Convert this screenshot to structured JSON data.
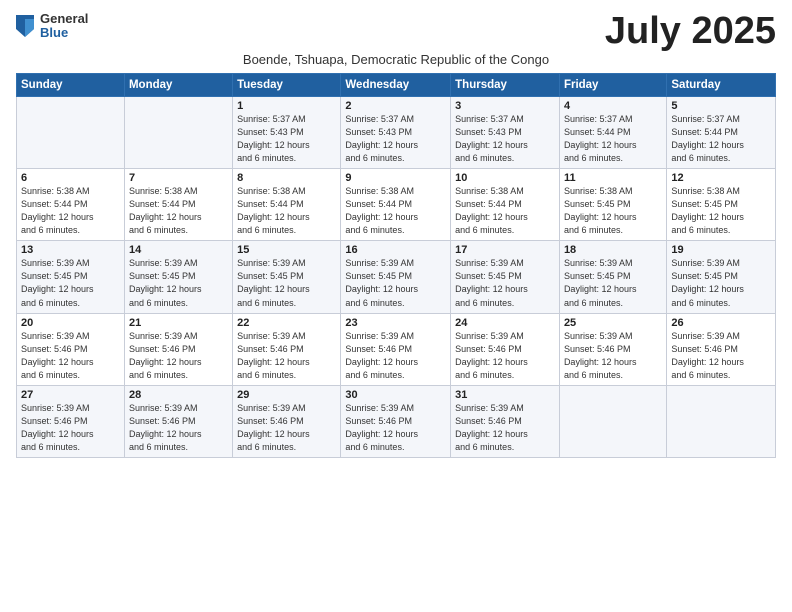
{
  "logo": {
    "general": "General",
    "blue": "Blue"
  },
  "title": "July 2025",
  "subtitle": "Boende, Tshuapa, Democratic Republic of the Congo",
  "days_header": [
    "Sunday",
    "Monday",
    "Tuesday",
    "Wednesday",
    "Thursday",
    "Friday",
    "Saturday"
  ],
  "weeks": [
    [
      {
        "day": "",
        "info": ""
      },
      {
        "day": "",
        "info": ""
      },
      {
        "day": "1",
        "info": "Sunrise: 5:37 AM\nSunset: 5:43 PM\nDaylight: 12 hours\nand 6 minutes."
      },
      {
        "day": "2",
        "info": "Sunrise: 5:37 AM\nSunset: 5:43 PM\nDaylight: 12 hours\nand 6 minutes."
      },
      {
        "day": "3",
        "info": "Sunrise: 5:37 AM\nSunset: 5:43 PM\nDaylight: 12 hours\nand 6 minutes."
      },
      {
        "day": "4",
        "info": "Sunrise: 5:37 AM\nSunset: 5:44 PM\nDaylight: 12 hours\nand 6 minutes."
      },
      {
        "day": "5",
        "info": "Sunrise: 5:37 AM\nSunset: 5:44 PM\nDaylight: 12 hours\nand 6 minutes."
      }
    ],
    [
      {
        "day": "6",
        "info": "Sunrise: 5:38 AM\nSunset: 5:44 PM\nDaylight: 12 hours\nand 6 minutes."
      },
      {
        "day": "7",
        "info": "Sunrise: 5:38 AM\nSunset: 5:44 PM\nDaylight: 12 hours\nand 6 minutes."
      },
      {
        "day": "8",
        "info": "Sunrise: 5:38 AM\nSunset: 5:44 PM\nDaylight: 12 hours\nand 6 minutes."
      },
      {
        "day": "9",
        "info": "Sunrise: 5:38 AM\nSunset: 5:44 PM\nDaylight: 12 hours\nand 6 minutes."
      },
      {
        "day": "10",
        "info": "Sunrise: 5:38 AM\nSunset: 5:44 PM\nDaylight: 12 hours\nand 6 minutes."
      },
      {
        "day": "11",
        "info": "Sunrise: 5:38 AM\nSunset: 5:45 PM\nDaylight: 12 hours\nand 6 minutes."
      },
      {
        "day": "12",
        "info": "Sunrise: 5:38 AM\nSunset: 5:45 PM\nDaylight: 12 hours\nand 6 minutes."
      }
    ],
    [
      {
        "day": "13",
        "info": "Sunrise: 5:39 AM\nSunset: 5:45 PM\nDaylight: 12 hours\nand 6 minutes."
      },
      {
        "day": "14",
        "info": "Sunrise: 5:39 AM\nSunset: 5:45 PM\nDaylight: 12 hours\nand 6 minutes."
      },
      {
        "day": "15",
        "info": "Sunrise: 5:39 AM\nSunset: 5:45 PM\nDaylight: 12 hours\nand 6 minutes."
      },
      {
        "day": "16",
        "info": "Sunrise: 5:39 AM\nSunset: 5:45 PM\nDaylight: 12 hours\nand 6 minutes."
      },
      {
        "day": "17",
        "info": "Sunrise: 5:39 AM\nSunset: 5:45 PM\nDaylight: 12 hours\nand 6 minutes."
      },
      {
        "day": "18",
        "info": "Sunrise: 5:39 AM\nSunset: 5:45 PM\nDaylight: 12 hours\nand 6 minutes."
      },
      {
        "day": "19",
        "info": "Sunrise: 5:39 AM\nSunset: 5:45 PM\nDaylight: 12 hours\nand 6 minutes."
      }
    ],
    [
      {
        "day": "20",
        "info": "Sunrise: 5:39 AM\nSunset: 5:46 PM\nDaylight: 12 hours\nand 6 minutes."
      },
      {
        "day": "21",
        "info": "Sunrise: 5:39 AM\nSunset: 5:46 PM\nDaylight: 12 hours\nand 6 minutes."
      },
      {
        "day": "22",
        "info": "Sunrise: 5:39 AM\nSunset: 5:46 PM\nDaylight: 12 hours\nand 6 minutes."
      },
      {
        "day": "23",
        "info": "Sunrise: 5:39 AM\nSunset: 5:46 PM\nDaylight: 12 hours\nand 6 minutes."
      },
      {
        "day": "24",
        "info": "Sunrise: 5:39 AM\nSunset: 5:46 PM\nDaylight: 12 hours\nand 6 minutes."
      },
      {
        "day": "25",
        "info": "Sunrise: 5:39 AM\nSunset: 5:46 PM\nDaylight: 12 hours\nand 6 minutes."
      },
      {
        "day": "26",
        "info": "Sunrise: 5:39 AM\nSunset: 5:46 PM\nDaylight: 12 hours\nand 6 minutes."
      }
    ],
    [
      {
        "day": "27",
        "info": "Sunrise: 5:39 AM\nSunset: 5:46 PM\nDaylight: 12 hours\nand 6 minutes."
      },
      {
        "day": "28",
        "info": "Sunrise: 5:39 AM\nSunset: 5:46 PM\nDaylight: 12 hours\nand 6 minutes."
      },
      {
        "day": "29",
        "info": "Sunrise: 5:39 AM\nSunset: 5:46 PM\nDaylight: 12 hours\nand 6 minutes."
      },
      {
        "day": "30",
        "info": "Sunrise: 5:39 AM\nSunset: 5:46 PM\nDaylight: 12 hours\nand 6 minutes."
      },
      {
        "day": "31",
        "info": "Sunrise: 5:39 AM\nSunset: 5:46 PM\nDaylight: 12 hours\nand 6 minutes."
      },
      {
        "day": "",
        "info": ""
      },
      {
        "day": "",
        "info": ""
      }
    ]
  ]
}
